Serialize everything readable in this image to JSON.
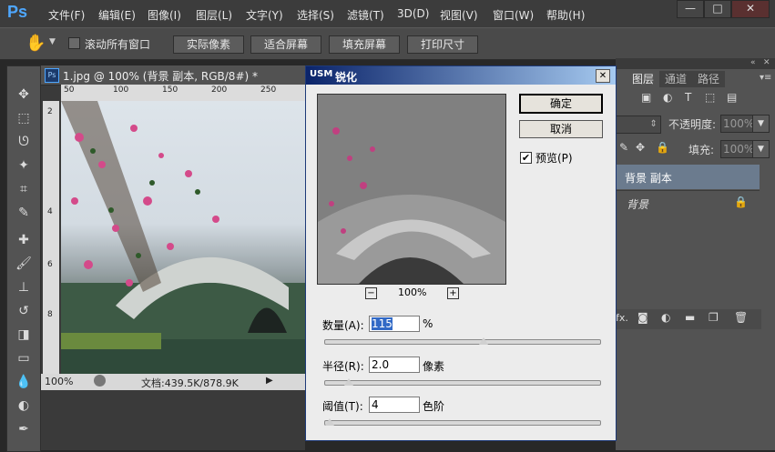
{
  "app": {
    "logo": "Ps"
  },
  "menu": [
    "文件(F)",
    "编辑(E)",
    "图像(I)",
    "图层(L)",
    "文字(Y)",
    "选择(S)",
    "滤镜(T)",
    "3D(D)",
    "视图(V)",
    "窗口(W)",
    "帮助(H)"
  ],
  "window_controls": {
    "minimize": "—",
    "maximize": "□",
    "close": "✕"
  },
  "options": {
    "scroll_all_label": "滚动所有窗口",
    "buttons": [
      "实际像素",
      "适合屏幕",
      "填充屏幕",
      "打印尺寸"
    ]
  },
  "document": {
    "tab_title": "1.jpg @ 100% (背景 副本, RGB/8#) *",
    "ruler_top_ticks": [
      "50",
      "100",
      "150",
      "200",
      "250"
    ],
    "ruler_left_ticks": [
      "2",
      "4",
      "6",
      "8"
    ],
    "zoom": "100%",
    "doc_info": "文档:439.5K/878.9K"
  },
  "dialog": {
    "title": "锐化",
    "title_prefix": "USM",
    "ok": "确定",
    "cancel": "取消",
    "preview_label": "预览(P)",
    "preview_zoom": "100%",
    "preview_checked": true,
    "amount": {
      "label": "数量(A):",
      "value": "115",
      "unit": "%",
      "level": 0.58
    },
    "radius": {
      "label": "半径(R):",
      "value": "2.0",
      "unit": "像素",
      "level": 0.09
    },
    "threshold": {
      "label": "阈值(T):",
      "value": "4",
      "unit": "色阶",
      "level": 0.02
    }
  },
  "panel": {
    "tabs": [
      "图层",
      "通道",
      "路径"
    ],
    "opacity_label": "不透明度:",
    "opacity_value": "100%",
    "fill_label": "填充:",
    "fill_value": "100%",
    "layers": [
      {
        "name": "背景 副本",
        "selected": true
      },
      {
        "name": "背景",
        "selected": false
      }
    ]
  }
}
